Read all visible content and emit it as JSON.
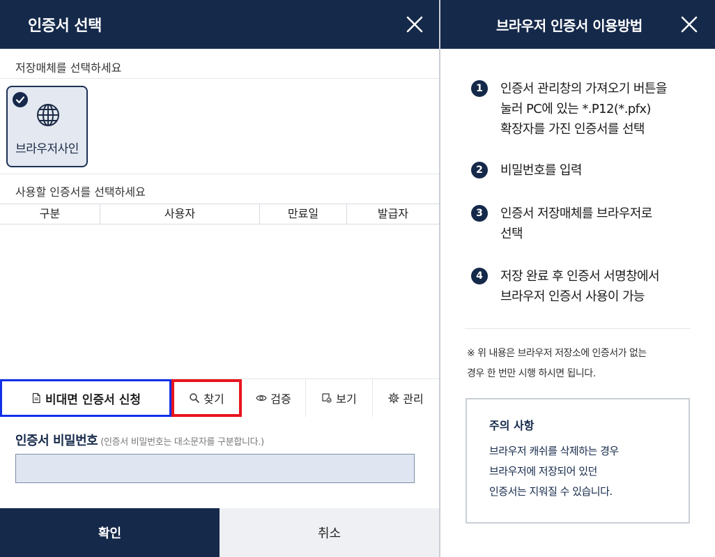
{
  "dialog": {
    "title": "인증서 선택",
    "media_prompt": "저장매체를 선택하세요",
    "media": {
      "label": "브라우저사인",
      "selected": true
    },
    "cert_prompt": "사용할 인증서를 선택하세요",
    "table": {
      "columns": [
        "구분",
        "사용자",
        "만료일",
        "발급자"
      ],
      "rows": []
    },
    "buttons": {
      "apply": "비대면 인증서 신청",
      "find": "찾기",
      "verify": "검증",
      "view": "보기",
      "manage": "관리"
    },
    "password": {
      "label": "인증서 비밀번호",
      "hint": "(인증서 비밀번호는 대소문자를 구분합니다.)",
      "value": ""
    },
    "ok_label": "확인",
    "cancel_label": "취소"
  },
  "help": {
    "title": "브라우저 인증서 이용방법",
    "steps": [
      {
        "num": "1",
        "lines": [
          "인증서 관리창의 가져오기 버튼을",
          "눌러 PC에 있는 *.P12(*.pfx)",
          "확장자를 가진 인증서를 선택"
        ]
      },
      {
        "num": "2",
        "lines": [
          "비밀번호를 입력"
        ]
      },
      {
        "num": "3",
        "lines": [
          "인증서 저장매체를 브라우저로",
          "선택"
        ]
      },
      {
        "num": "4",
        "lines": [
          "저장 완료 후 인증서 서명창에서",
          "브라우저 인증서 사용이 가능"
        ]
      }
    ],
    "note_lines": [
      "※ 위 내용은 브라우저 저장소에 인증서가 없는",
      "경우 한 번만 시행 하시면 됩니다."
    ],
    "caution": {
      "title": "주의 사항",
      "lines": [
        "브라우저 캐쉬를 삭제하는 경우",
        "브라우저에 저장되어 있던",
        "인증서는 지워질 수 있습니다."
      ]
    }
  },
  "colors": {
    "header_bg": "#15294a",
    "highlight_blue": "#1030e8",
    "highlight_red": "#e8141e",
    "input_bg": "#dfe6f2",
    "selected_card_bg": "#e3e8f1"
  },
  "icons": {
    "close": "close-icon",
    "media": "globe-icon",
    "selected": "check-icon",
    "apply": "document-icon",
    "find": "search-icon",
    "verify": "eye-icon",
    "view": "certificate-icon",
    "manage": "gear-icon"
  }
}
